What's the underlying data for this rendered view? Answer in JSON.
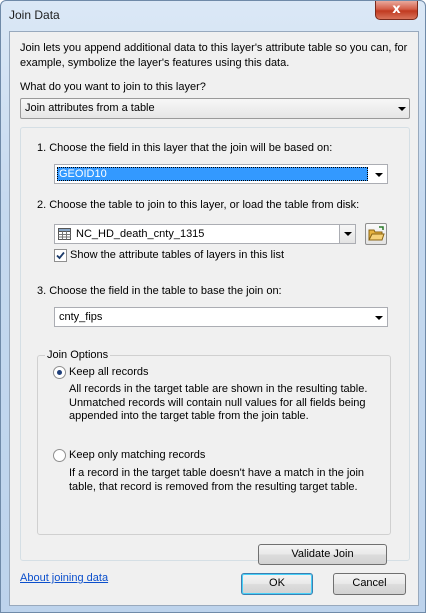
{
  "window": {
    "title": "Join Data",
    "close_label": "x"
  },
  "intro": "Join lets you append additional data to this layer's attribute table so you can, for example, symbolize the layer's features using this data.",
  "question": "What do you want to join to this layer?",
  "join_type": {
    "selected": "Join attributes from a table"
  },
  "step1": {
    "label": "1.  Choose the field in this layer that the join will be based on:",
    "selected": "GEOID10"
  },
  "step2": {
    "label": "2.  Choose the table to join to this layer, or load the table from disk:",
    "selected": "NC_HD_death_cnty_1315",
    "icon": "table-icon",
    "folder_icon": "open-folder-icon",
    "show_attr_label": "Show the attribute tables of layers in this list",
    "show_attr_checked": true
  },
  "step3": {
    "label": "3.  Choose the field in the table to base the join on:",
    "selected": "cnty_fips"
  },
  "join_options": {
    "legend": "Join Options",
    "keep_all": {
      "label": "Keep all records",
      "checked": true,
      "description": "All records in the target table are shown in the resulting table. Unmatched records will contain null values for all fields being appended into the target table from the join table."
    },
    "keep_matching": {
      "label": "Keep only matching records",
      "checked": false,
      "description": "If a record in the target table doesn't have a match in the join table, that record is removed from the resulting target table."
    }
  },
  "buttons": {
    "validate": "Validate Join",
    "ok": "OK",
    "cancel": "Cancel"
  },
  "footer": {
    "about_link": "About joining data"
  }
}
